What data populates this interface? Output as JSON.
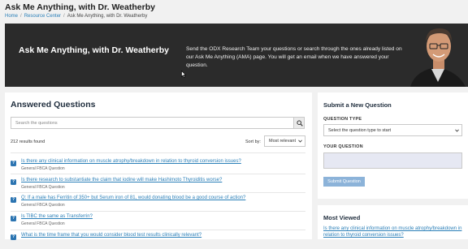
{
  "page": {
    "title": "Ask Me Anything, with Dr. Weatherby",
    "breadcrumb": [
      "Home",
      "Resource Center",
      "Ask Me Anything, with Dr. Weatherby"
    ]
  },
  "hero": {
    "title": "Ask Me Anything, with Dr. Weatherby",
    "description": "Send the ODX Research Team your questions or search through the ones already listed on our Ask Me Anything (AMA) page. You will get an email when we have answered your question."
  },
  "answered": {
    "heading": "Answered Questions",
    "search_placeholder": "Search the questions",
    "results_count": "212 results found",
    "sort_label": "Sort by:",
    "sort_value": "Most relevant",
    "questions": [
      {
        "text": "Is there any clinical information on muscle atrophy/breakdown in relation to thyroid conversion issues?",
        "category": "General FBCA Question"
      },
      {
        "text": "Is there research to substantiate the claim that iodine will make Hashimoto Thyroiditis worse?",
        "category": "General FBCA Question"
      },
      {
        "text": "Q: If a male has Ferritin of 350+ but Serum iron of 81, would donating blood be a good course of action?",
        "category": "General FBCA Question"
      },
      {
        "text": "Is TIBC the same as Transferrin?",
        "category": "General FBCA Question"
      },
      {
        "text": "What is the time frame that you would consider blood test results clinically relevant?",
        "category": ""
      }
    ]
  },
  "submit": {
    "heading": "Submit a New Question",
    "type_label": "QUESTION TYPE",
    "type_placeholder": "Select the question type to start",
    "question_label": "YOUR QUESTION",
    "button": "Submit Question"
  },
  "most_viewed": {
    "heading": "Most Viewed",
    "first_item": "Is there any clinical information on muscle atrophy/breakdown in relation to thyroid conversion issues?"
  },
  "colors": {
    "accent": "#2a7fb8",
    "hero_bg": "#2b2b2b",
    "button": "#8cb3d9"
  },
  "icons": [
    "search-icon",
    "question-icon",
    "chevron-down-icon",
    "mouse-cursor-icon"
  ]
}
